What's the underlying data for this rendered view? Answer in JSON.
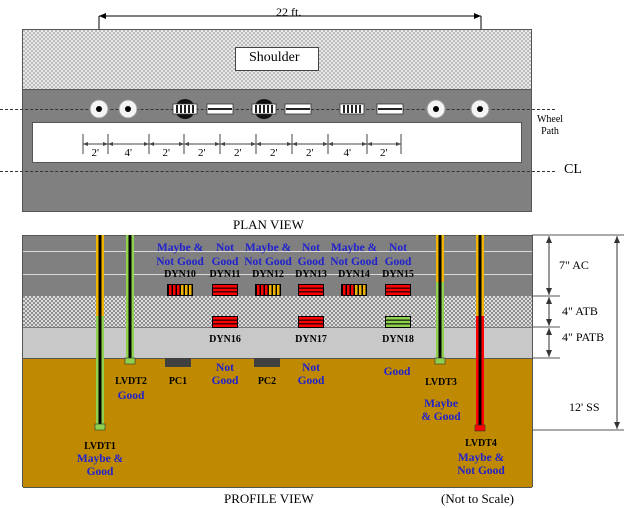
{
  "plan_view": {
    "title": "PLAN VIEW",
    "overall_dimension": "22 ft.",
    "shoulder_label": "Shoulder",
    "wheel_path_label_line1": "Wheel",
    "wheel_path_label_line2": "Path",
    "centerline_label": "CL",
    "spacings": [
      "2'",
      "4'",
      "2'",
      "2'",
      "2'",
      "2'",
      "2'",
      "4'",
      "2'"
    ],
    "sensor_symbols": [
      "lvdt",
      "lvdt",
      "dyn-vertical",
      "dyn-horizontal",
      "dyn-vertical",
      "dyn-horizontal",
      "dyn-vertical-small",
      "dyn-horizontal",
      "lvdt",
      "lvdt"
    ]
  },
  "profile_view": {
    "title": "PROFILE VIEW",
    "scale_note": "(Not to Scale)",
    "layers": [
      {
        "name": "AC",
        "label": "7\" AC"
      },
      {
        "name": "ATB",
        "label": "4\" ATB"
      },
      {
        "name": "PATB",
        "label": "4\" PATB"
      },
      {
        "name": "SS",
        "label": "12' SS"
      }
    ],
    "dyn_sensors_ac": [
      {
        "id": "DYN10",
        "status_line1": "Maybe &",
        "status_line2": "Not Good",
        "pattern": "vertical-mixed"
      },
      {
        "id": "DYN11",
        "status_line1": "Not",
        "status_line2": "Good",
        "pattern": "horizontal-red"
      },
      {
        "id": "DYN12",
        "status_line1": "Maybe &",
        "status_line2": "Not Good",
        "pattern": "vertical-mixed"
      },
      {
        "id": "DYN13",
        "status_line1": "Not",
        "status_line2": "Good",
        "pattern": "horizontal-red"
      },
      {
        "id": "DYN14",
        "status_line1": "Maybe &",
        "status_line2": "Not Good",
        "pattern": "vertical-mixed"
      },
      {
        "id": "DYN15",
        "status_line1": "Not",
        "status_line2": "Good",
        "pattern": "horizontal-red"
      }
    ],
    "dyn_sensors_atb": [
      {
        "id": "DYN16",
        "pattern": "horizontal-red"
      },
      {
        "id": "DYN17",
        "pattern": "horizontal-red"
      },
      {
        "id": "DYN18",
        "pattern": "horizontal-green"
      }
    ],
    "dyn_statuses_below": [
      {
        "line1": "Not",
        "line2": "Good"
      },
      {
        "line1": "Not",
        "line2": "Good"
      },
      {
        "line1": "Good",
        "line2": ""
      }
    ],
    "pressure_cells": [
      {
        "id": "PC1"
      },
      {
        "id": "PC2"
      }
    ],
    "lvdts": [
      {
        "id": "LVDT1",
        "status_line1": "Maybe &",
        "status_line2": "Good"
      },
      {
        "id": "LVDT2",
        "status_line1": "Good",
        "status_line2": ""
      },
      {
        "id": "LVDT3",
        "status_line1": "Maybe",
        "status_line2": "& Good"
      },
      {
        "id": "LVDT4",
        "status_line1": "Maybe &",
        "status_line2": "Not Good"
      }
    ]
  },
  "colors": {
    "status_text": "#2222cc",
    "red": "#ff0000",
    "yellow": "#f0b400",
    "green": "#8fd14f",
    "subgrade": "#bf8a00",
    "asphalt": "#808080",
    "pc": "#404040"
  }
}
